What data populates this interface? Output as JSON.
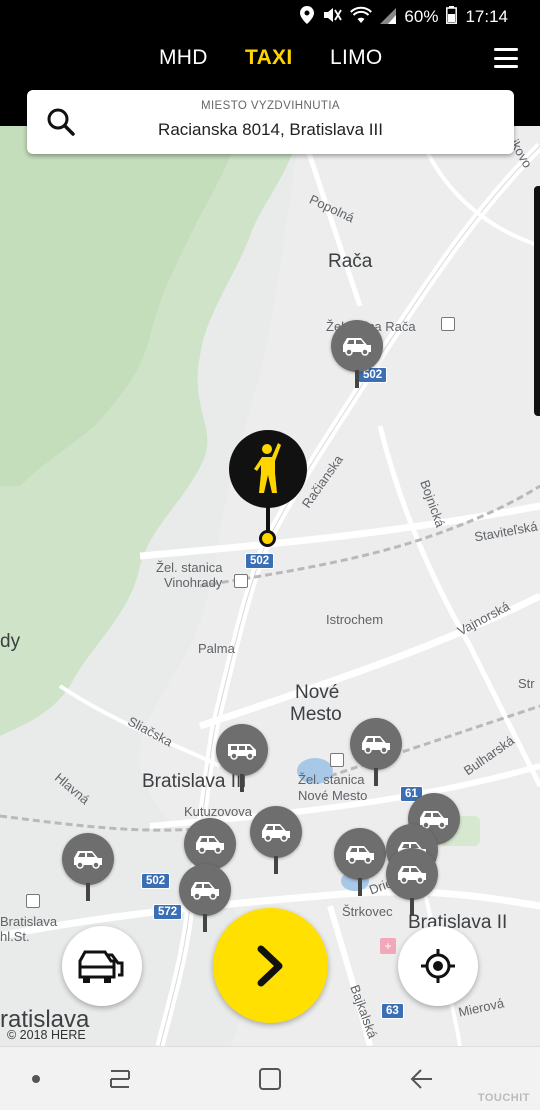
{
  "status_bar": {
    "battery": "60%",
    "time": "17:14",
    "icons": [
      "location-icon",
      "mute-icon",
      "wifi-icon",
      "signal-icon",
      "battery-icon"
    ]
  },
  "header": {
    "tabs": [
      {
        "label": "MHD",
        "active": false
      },
      {
        "label": "TAXI",
        "active": true
      },
      {
        "label": "LIMO",
        "active": false
      }
    ],
    "menu_icon": "hamburger-menu-icon",
    "accent_color": "#ffd500"
  },
  "search": {
    "label": "MIESTO VYZDVIHNUTIA",
    "value": "Racianska 8014, Bratislava III",
    "icon": "search-icon"
  },
  "map": {
    "labels": {
      "raca": "Rača",
      "zst_raca": "Železnica Rača",
      "popolna": "Popolná",
      "racianska": "Račianska",
      "bojnicka": "Bojnická",
      "stavitelska": "Staviteľská",
      "vajnorska": "Vajnorská",
      "zst_vinohrady_1": "Žel. stanica",
      "zst_vinohrady_2": "Vinohrady",
      "istrochem": "Istrochem",
      "palma": "Palma",
      "nove_mesto_1": "Nové",
      "nove_mesto_2": "Mesto",
      "sliacska": "Sliačska",
      "bratislava_iii": "Bratislava III",
      "zst_nm_1": "Žel. stanica",
      "zst_nm_2": "Nové Mesto",
      "bulharska": "Bulharská",
      "hlavna": "Hlavná",
      "kutuzovova": "Kutuzovova",
      "drienova": "Drieňová",
      "strkovec": "Štrkovec",
      "bratislava_ii": "Bratislava II",
      "bratislava_hlst_1": "Bratislava",
      "bratislava_hlst_2": "hl.St.",
      "bratislava": "ratislava",
      "bajkalska": "Bajkalská",
      "mierova": "Mierová",
      "left_edge": "dy",
      "right_edge": "Str",
      "top_right": "jkovo"
    },
    "route_badges": {
      "b1": "502",
      "b2": "502",
      "b3": "502",
      "b4": "572",
      "b5": "61",
      "b6": "63"
    },
    "copyright": "© 2018 HERE",
    "taxi_count": 11
  },
  "actions": {
    "cars_button_icon": "cars-icon",
    "go_button_icon": "chevron-right-icon",
    "locate_button_icon": "crosshair-icon"
  },
  "navbar": {
    "icons": [
      "dot-icon",
      "recents-icon",
      "home-icon",
      "back-icon"
    ],
    "watermark": "TOUCHIT"
  }
}
